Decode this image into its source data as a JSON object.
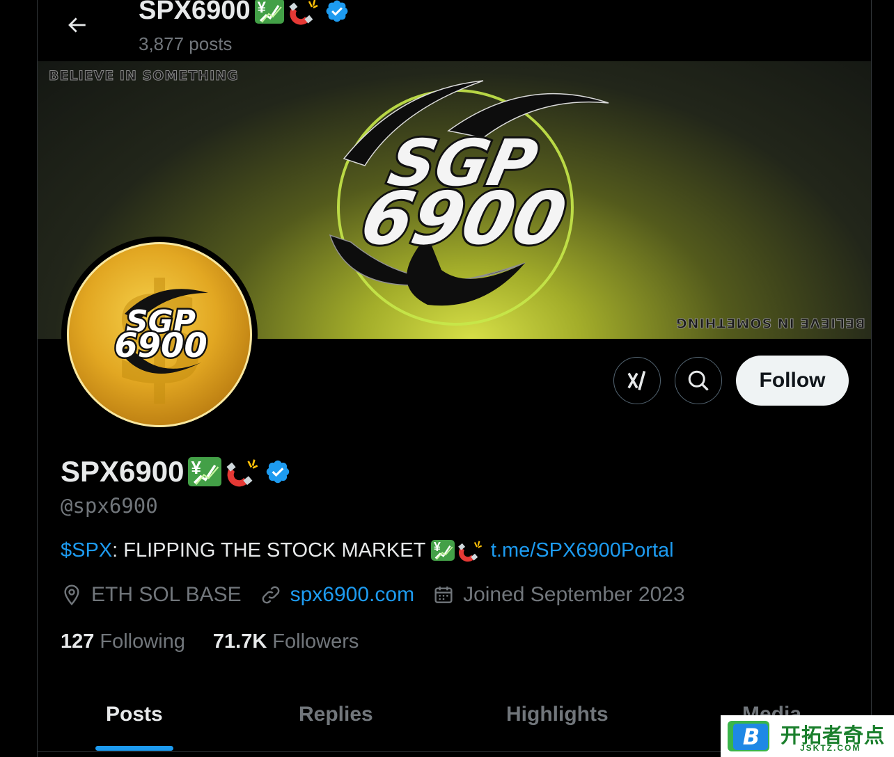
{
  "header": {
    "display_name": "SPX6900",
    "posts_count": "3,877 posts"
  },
  "banner": {
    "tagline": "BELIEVE IN SOMETHING",
    "logo_line1": "SGP",
    "logo_line2": "6900"
  },
  "avatar": {
    "logo_line1": "SGP",
    "logo_line2": "6900"
  },
  "actions": {
    "follow_label": "Follow"
  },
  "profile": {
    "display_name": "SPX6900",
    "handle": "@spx6900",
    "bio_ticker": "$SPX",
    "bio_text": ": FLIPPING THE STOCK MARKET ",
    "bio_link": "t.me/SPX6900Portal",
    "location": "ETH SOL BASE",
    "website": "spx6900.com",
    "joined": "Joined September 2023",
    "following_count": "127",
    "following_label": "Following",
    "followers_count": "71.7K",
    "followers_label": "Followers"
  },
  "tabs": [
    {
      "label": "Posts",
      "active": true
    },
    {
      "label": "Replies",
      "active": false
    },
    {
      "label": "Highlights",
      "active": false
    },
    {
      "label": "Media",
      "active": false
    }
  ],
  "watermark": {
    "text": "开拓者奇点",
    "sub": "JSKTZ.COM",
    "logo_letter": "B"
  },
  "colors": {
    "accent": "#1d9bf0",
    "background": "#000000",
    "muted": "#71767b",
    "verified": "#1d9bf0"
  },
  "icons": [
    "back-arrow-icon",
    "verified-badge-icon",
    "chart-yen-emoji",
    "magnet-emoji",
    "grok-icon",
    "search-icon",
    "location-icon",
    "link-icon",
    "calendar-icon"
  ]
}
